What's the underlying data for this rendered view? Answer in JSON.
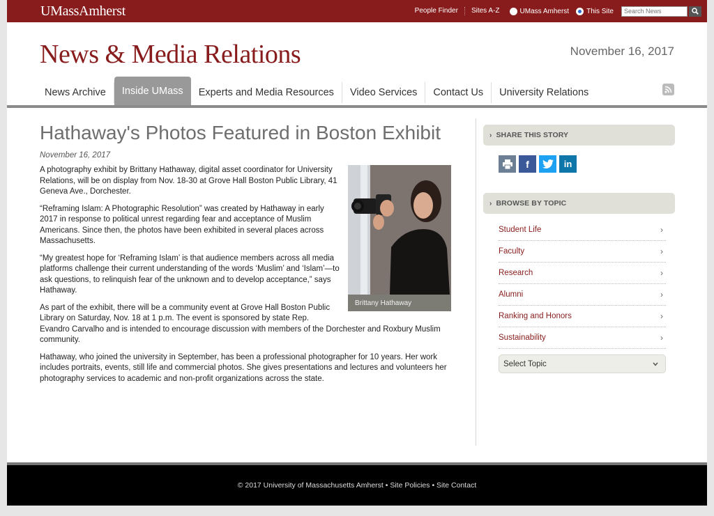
{
  "topbar": {
    "brand": "UMassAmherst",
    "links": [
      "People Finder",
      "Sites A-Z"
    ],
    "radio_umass": "UMass Amherst",
    "radio_site": "This Site",
    "search_placeholder": "Search News"
  },
  "header": {
    "site_title": "News & Media Relations",
    "date": "November 16, 2017"
  },
  "nav": {
    "items": [
      "News Archive",
      "Inside UMass",
      "Experts and Media Resources",
      "Video Services",
      "Contact Us",
      "University Relations"
    ],
    "active": "Inside UMass"
  },
  "article": {
    "headline": "Hathaway's Photos Featured in Boston Exhibit",
    "date": "November 16, 2017",
    "caption": "Brittany Hathaway",
    "paragraphs": [
      "A photography exhibit by Brittany Hathaway, digital asset coordinator for University Relations, will be on display from Nov. 18-30 at Grove Hall Boston Public Library, 41 Geneva Ave., Dorchester.",
      "“Reframing Islam: A Photographic Resolution” was created by Hathaway in early 2017 in response to political unrest regarding fear and acceptance of Muslim Americans. Since then, the photos have been exhibited in several places across Massachusetts.",
      "“My greatest hope for ‘Reframing Islam’ is that audience members across all media platforms challenge their current understanding of the words ‘Muslim’ and ‘Islam’—to ask questions, to relinquish fear of the unknown and to develop acceptance,” says Hathaway.",
      "As part of the exhibit, there will be a community event at Grove Hall Boston Public Library on Saturday, Nov. 18 at 1 p.m. The event is sponsored by state Rep. Evandro Carvalho and is intended to encourage discussion with members of the Dorchester and Roxbury Muslim community.",
      "Hathaway, who joined the university in September, has been a professional photographer for 10 years. Her work includes portraits, events, still life and commercial photos. She gives presentations and lectures and volunteers her photography services to academic and non-profit organizations across the state."
    ]
  },
  "sidebar": {
    "share_title": "SHARE THIS STORY",
    "browse_title": "BROWSE BY TOPIC",
    "topics": [
      "Student Life",
      "Faculty",
      "Research",
      "Alumni",
      "Ranking and Honors",
      "Sustainability"
    ],
    "select_label": "Select Topic"
  },
  "footer": {
    "text": "© 2017 University of Massachusetts Amherst • Site Policies • Site Contact"
  },
  "colors": {
    "brand": "#881c1c",
    "nav_active": "#999999",
    "facebook": "#3b5998",
    "twitter": "#1da1f2",
    "linkedin": "#0e76a8"
  }
}
